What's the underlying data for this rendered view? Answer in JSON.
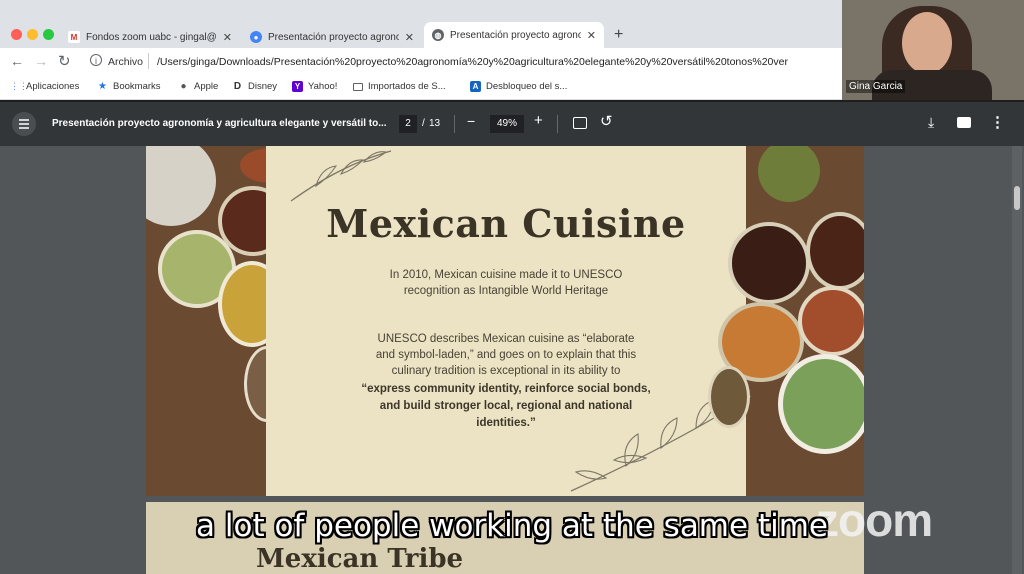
{
  "tabs": [
    {
      "title": "Fondos zoom uabc - gingal@u",
      "icon": "gmail-icon",
      "active": false
    },
    {
      "title": "Presentación proyecto agrono",
      "icon": "chrome-icon",
      "active": false
    },
    {
      "title": "Presentación proyecto agrono",
      "icon": "globe-icon",
      "active": true
    }
  ],
  "address": {
    "label": "Archivo",
    "url": "/Users/ginga/Downloads/Presentación%20proyecto%20agronomía%20y%20agricultura%20elegante%20y%20versátil%20tonos%20ver"
  },
  "bookmarks": [
    {
      "label": "Aplicaciones",
      "icon": "apps-grid-icon",
      "color": "#4285f4"
    },
    {
      "label": "Bookmarks",
      "icon": "star-icon",
      "color": "#1a73e8"
    },
    {
      "label": "Apple",
      "icon": "apple-icon",
      "color": "#555555"
    },
    {
      "label": "Disney",
      "icon": "disney-icon",
      "color": "#333333"
    },
    {
      "label": "Yahoo!",
      "icon": "yahoo-icon",
      "color": "#6001d2"
    },
    {
      "label": "Importados de S...",
      "icon": "folder-icon",
      "color": "#5f6368"
    },
    {
      "label": "Desbloqueo del s...",
      "icon": "letter-a-icon",
      "color": "#1565c0"
    }
  ],
  "pdf": {
    "title": "Presentación proyecto agronomía y agricultura elegante y versátil to...",
    "page_current": "2",
    "page_sep": "/",
    "page_total": "13",
    "zoom": "49%"
  },
  "slide": {
    "title": "Mexican Cuisine",
    "line1": "In 2010, Mexican cuisine made it to UNESCO",
    "line2": "recognition as Intangible World Heritage",
    "para1": "UNESCO describes Mexican cuisine as “elaborate",
    "para2": "and symbol-laden,” and goes on to explain that this",
    "para3": "culinary tradition is exceptional in its ability to",
    "bold1": "“express community identity, reinforce social bonds,",
    "bold2": "and build stronger local, regional and national",
    "bold3": "identities.”"
  },
  "next_slide_partial": "Mexican Tribe",
  "caption": "a lot of people working at the same time",
  "zoom_watermark": "zoom",
  "participant": {
    "name": "Gina Garcia"
  },
  "colors": {
    "paper": "#ebe3c4",
    "title": "#3b3326",
    "toolbar": "#323639",
    "viewer_bg": "#525659"
  }
}
